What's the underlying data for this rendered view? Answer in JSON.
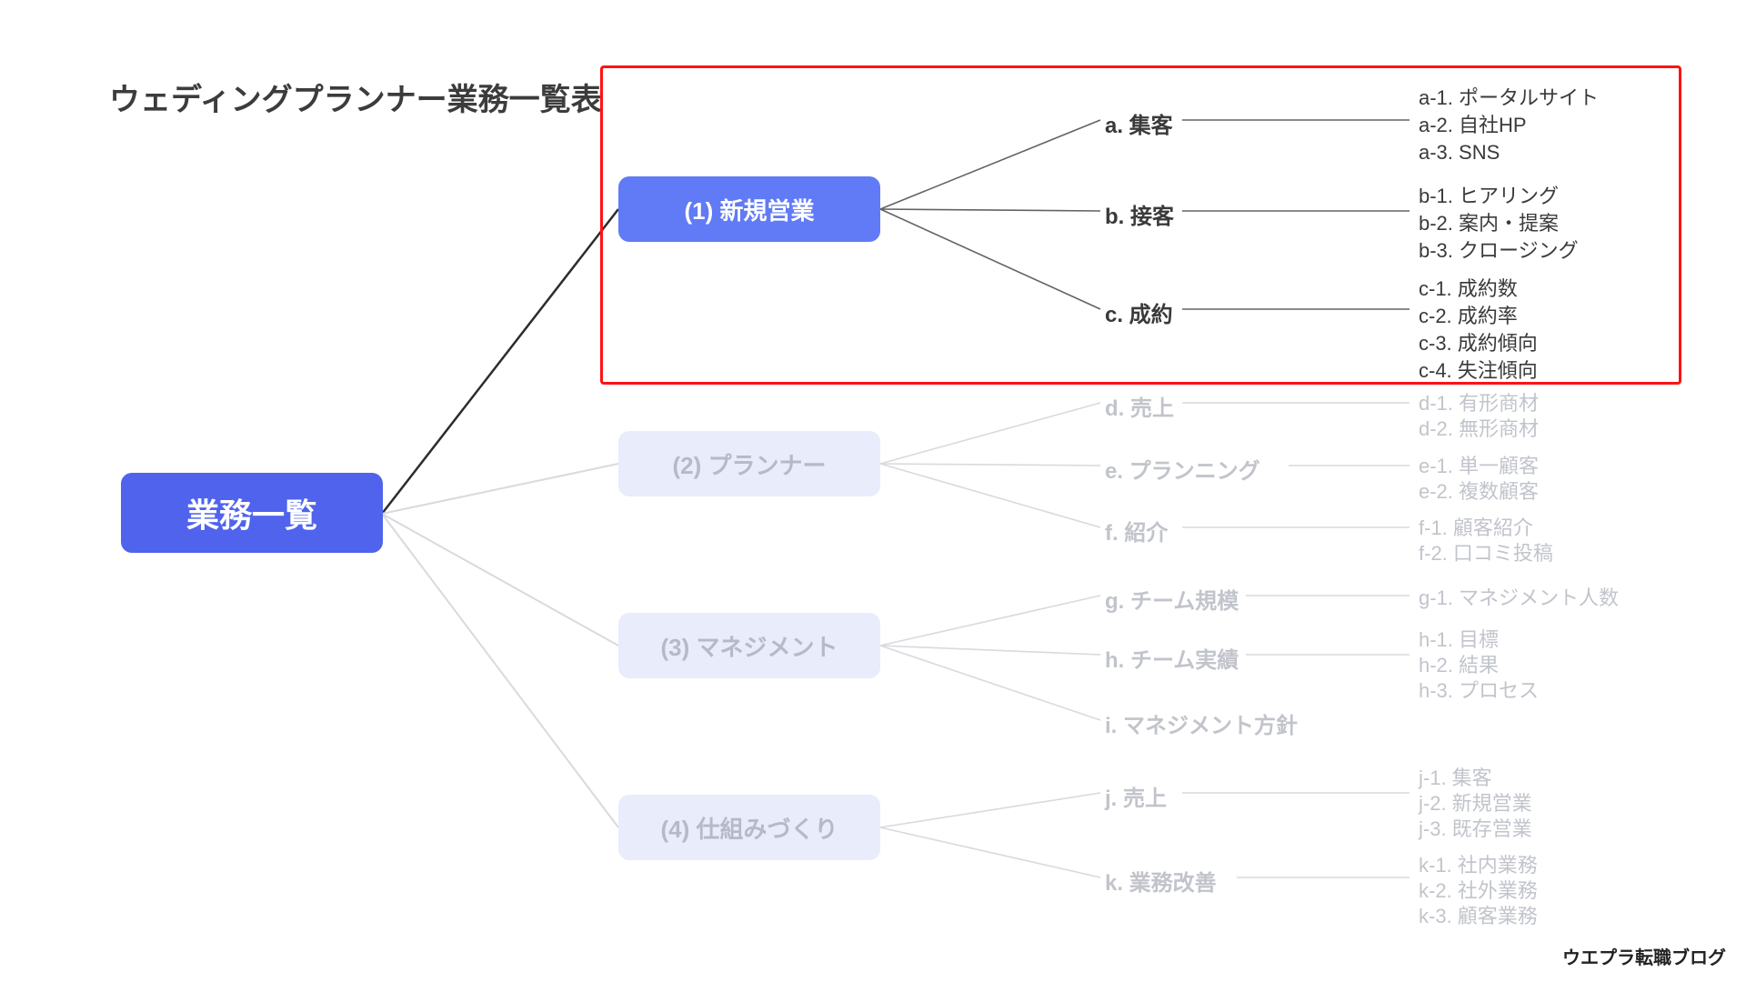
{
  "title": "ウェディングプランナー業務一覧表",
  "attribution": "ウエプラ転職ブログ",
  "root": "業務一覧",
  "cat1": "(1) 新規営業",
  "cat2": "(2) プランナー",
  "cat3": "(3) マネジメント",
  "cat4": "(4) 仕組みづくり",
  "sub_a": "a. 集客",
  "sub_b": "b. 接客",
  "sub_c": "c. 成約",
  "sub_d": "d. 売上",
  "sub_e": "e. プランニング",
  "sub_f": "f. 紹介",
  "sub_g": "g. チーム規模",
  "sub_h": "h. チーム実績",
  "sub_i": "i. マネジメント方針",
  "sub_j": "j. 売上",
  "sub_k": "k. 業務改善",
  "leaf_a1": "a-1. ポータルサイト",
  "leaf_a2": "a-2. 自社HP",
  "leaf_a3": "a-3. SNS",
  "leaf_b1": "b-1. ヒアリング",
  "leaf_b2": "b-2. 案内・提案",
  "leaf_b3": "b-3. クロージング",
  "leaf_c1": "c-1.  成約数",
  "leaf_c2": "c-2. 成約率",
  "leaf_c3": "c-3. 成約傾向",
  "leaf_c4": "c-4. 失注傾向",
  "leaf_d1": "d-1. 有形商材",
  "leaf_d2": "d-2. 無形商材",
  "leaf_e1": "e-1. 単一顧客",
  "leaf_e2": "e-2. 複数顧客",
  "leaf_f1": "f-1. 顧客紹介",
  "leaf_f2": "f-2. 口コミ投稿",
  "leaf_g1": "g-1. マネジメント人数",
  "leaf_h1": "h-1. 目標",
  "leaf_h2": "h-2. 結果",
  "leaf_h3": "h-3. プロセス",
  "leaf_j1": "j-1. 集客",
  "leaf_j2": "j-2. 新規営業",
  "leaf_j3": "j-3. 既存営業",
  "leaf_k1": "k-1. 社内業務",
  "leaf_k2": "k-2. 社外業務",
  "leaf_k3": "k-3. 顧客業務"
}
